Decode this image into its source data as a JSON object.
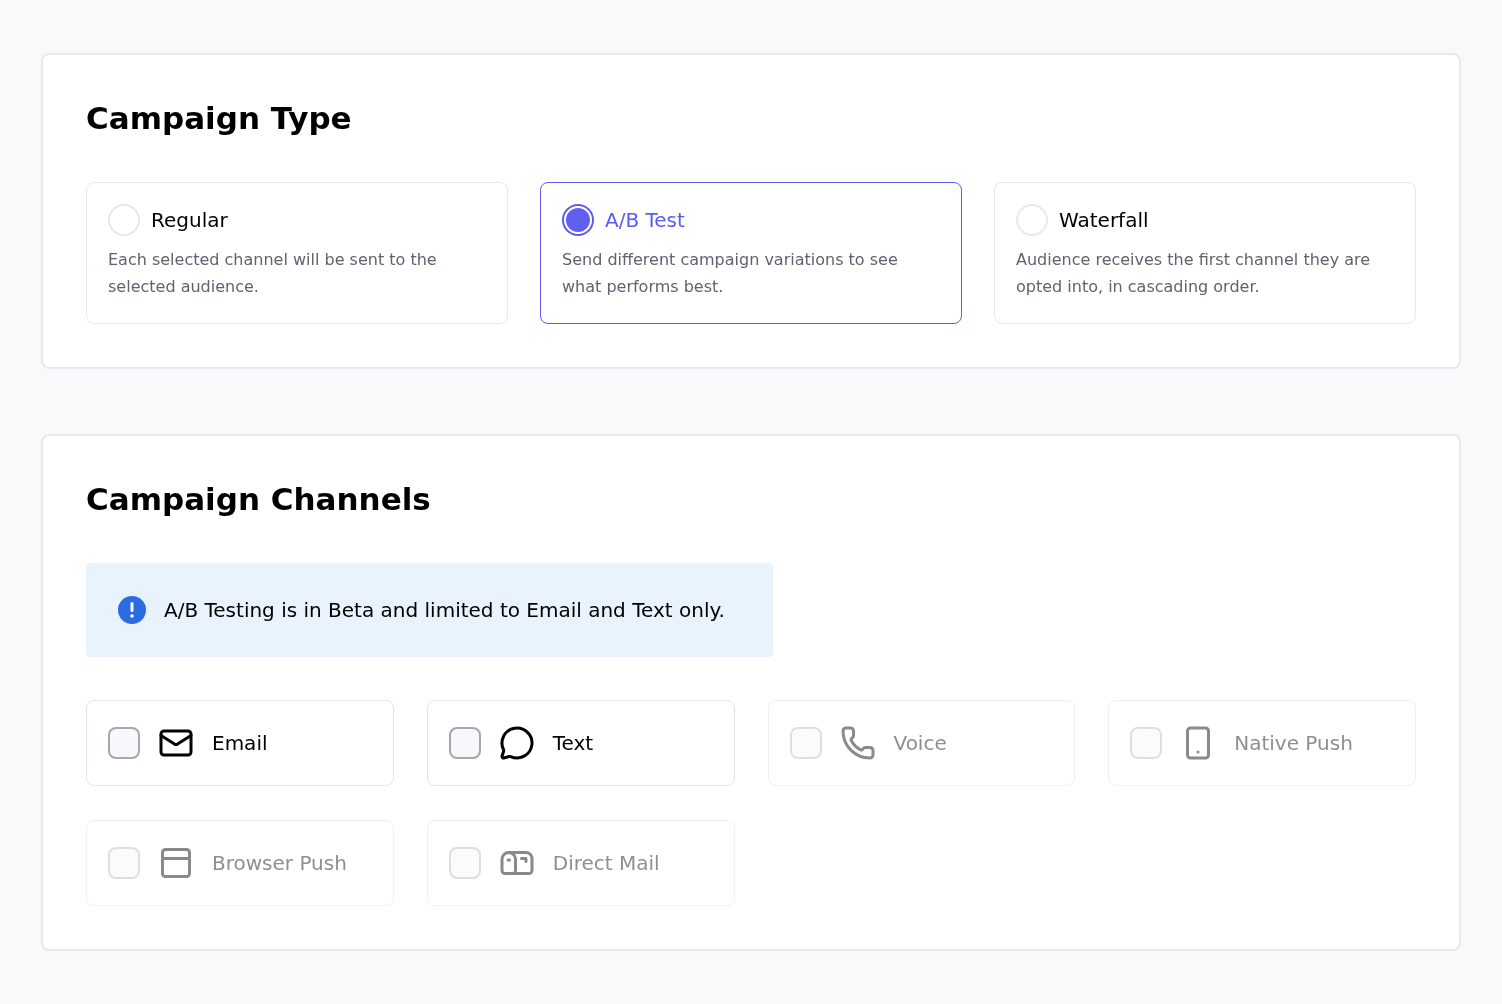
{
  "campaign_type": {
    "title": "Campaign Type",
    "options": [
      {
        "label": "Regular",
        "description": "Each selected channel will be sent to the selected audience.",
        "selected": false
      },
      {
        "label": "A/B Test",
        "description": "Send different campaign variations to see what performs best.",
        "selected": true
      },
      {
        "label": "Waterfall",
        "description": "Audience receives the first channel they are opted into, in cascading order.",
        "selected": false
      }
    ]
  },
  "campaign_channels": {
    "title": "Campaign Channels",
    "notice": "A/B Testing is in Beta and limited to Email and Text only.",
    "channels": [
      {
        "label": "Email",
        "checked": false,
        "disabled": false
      },
      {
        "label": "Text",
        "checked": false,
        "disabled": false
      },
      {
        "label": "Voice",
        "checked": false,
        "disabled": true
      },
      {
        "label": "Native Push",
        "checked": false,
        "disabled": true
      },
      {
        "label": "Browser Push",
        "checked": false,
        "disabled": true
      },
      {
        "label": "Direct Mail",
        "checked": false,
        "disabled": true
      }
    ]
  }
}
